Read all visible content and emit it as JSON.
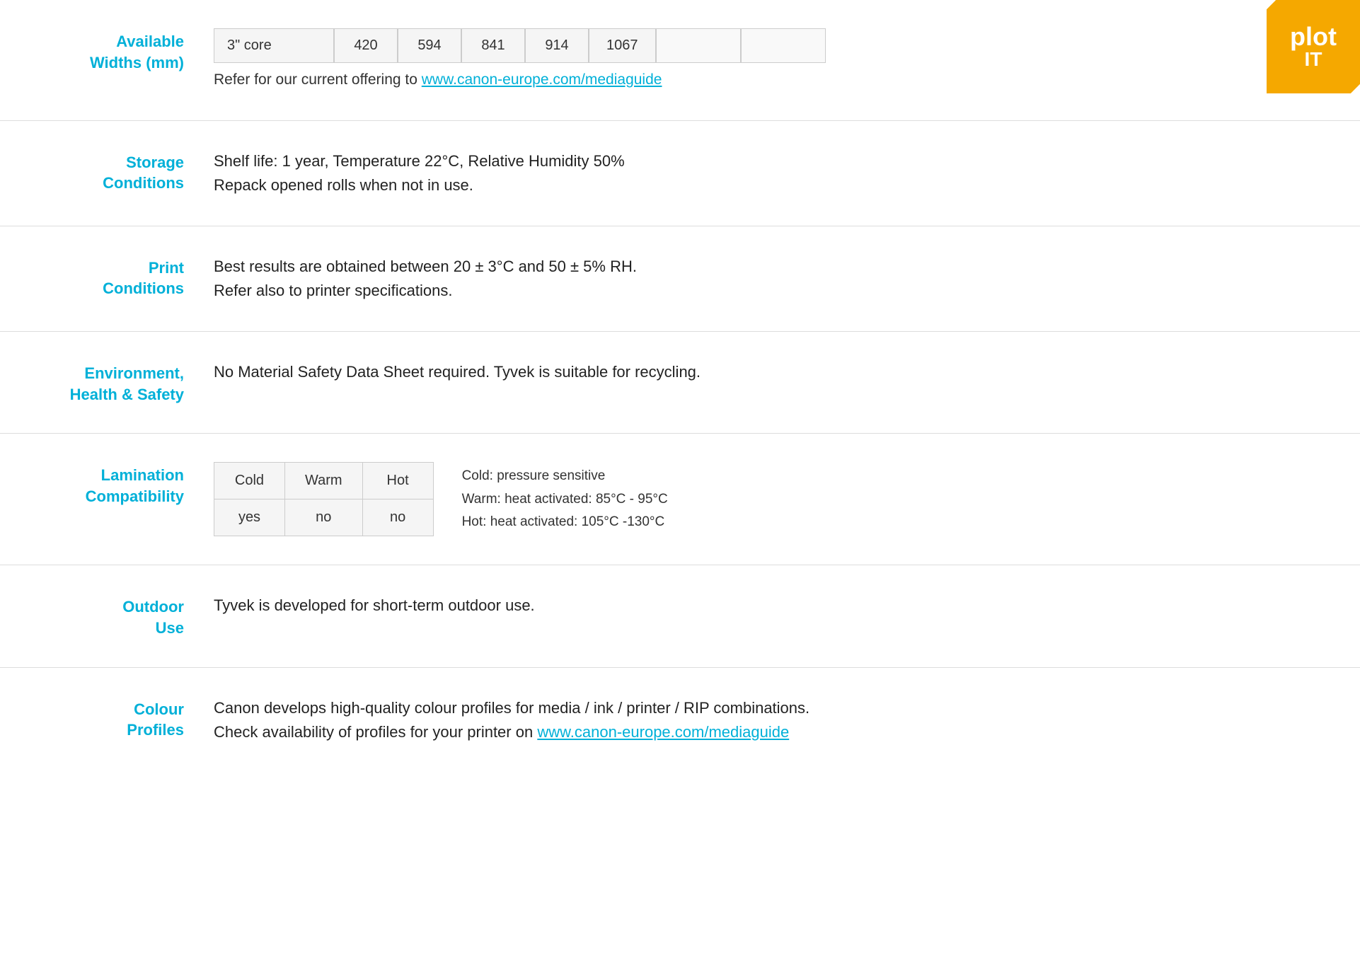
{
  "logo": {
    "text_plot": "plot",
    "text_it": "IT"
  },
  "rows": [
    {
      "id": "available-widths",
      "label_line1": "Available",
      "label_line2": "Widths (mm)",
      "widths": [
        "3\" core",
        "420",
        "594",
        "841",
        "914",
        "1067",
        "",
        ""
      ],
      "link_text": "Refer for our current offering to ",
      "link_href": "www.canon-europe.com/mediaguide",
      "link_url": "http://www.canon-europe.com/mediaguide"
    },
    {
      "id": "storage-conditions",
      "label_line1": "Storage",
      "label_line2": "Conditions",
      "content_lines": [
        "Shelf life: 1 year, Temperature 22°C, Relative Humidity 50%",
        "Repack opened rolls when not in use."
      ]
    },
    {
      "id": "print-conditions",
      "label_line1": "Print",
      "label_line2": "Conditions",
      "content_lines": [
        "Best results are obtained between 20 ± 3°C and 50 ± 5% RH.",
        "Refer also to printer specifications."
      ]
    },
    {
      "id": "environment-health-safety",
      "label_line1": "Environment,",
      "label_line2": "Health & Safety",
      "content_lines": [
        "No Material Safety Data Sheet required. Tyvek is suitable for recycling."
      ]
    },
    {
      "id": "lamination-compatibility",
      "label_line1": "Lamination",
      "label_line2": "Compatibility",
      "lam_headers": [
        "Cold",
        "Warm",
        "Hot"
      ],
      "lam_values": [
        "yes",
        "no",
        "no"
      ],
      "lam_notes": [
        "Cold: pressure sensitive",
        "Warm: heat activated: 85°C - 95°C",
        "Hot: heat activated: 105°C -130°C"
      ]
    },
    {
      "id": "outdoor-use",
      "label_line1": "Outdoor",
      "label_line2": "Use",
      "content_lines": [
        "Tyvek is developed for short-term outdoor use."
      ]
    },
    {
      "id": "colour-profiles",
      "label_line1": "Colour",
      "label_line2": "Profiles",
      "content_lines": [
        "Canon develops high-quality colour profiles for media / ink / printer / RIP combinations."
      ],
      "link_text2": "Check availability of profiles for your printer on ",
      "link_href2": "www.canon-europe.com/mediaguide",
      "link_url2": "http://www.canon-europe.com/mediaguide"
    }
  ]
}
